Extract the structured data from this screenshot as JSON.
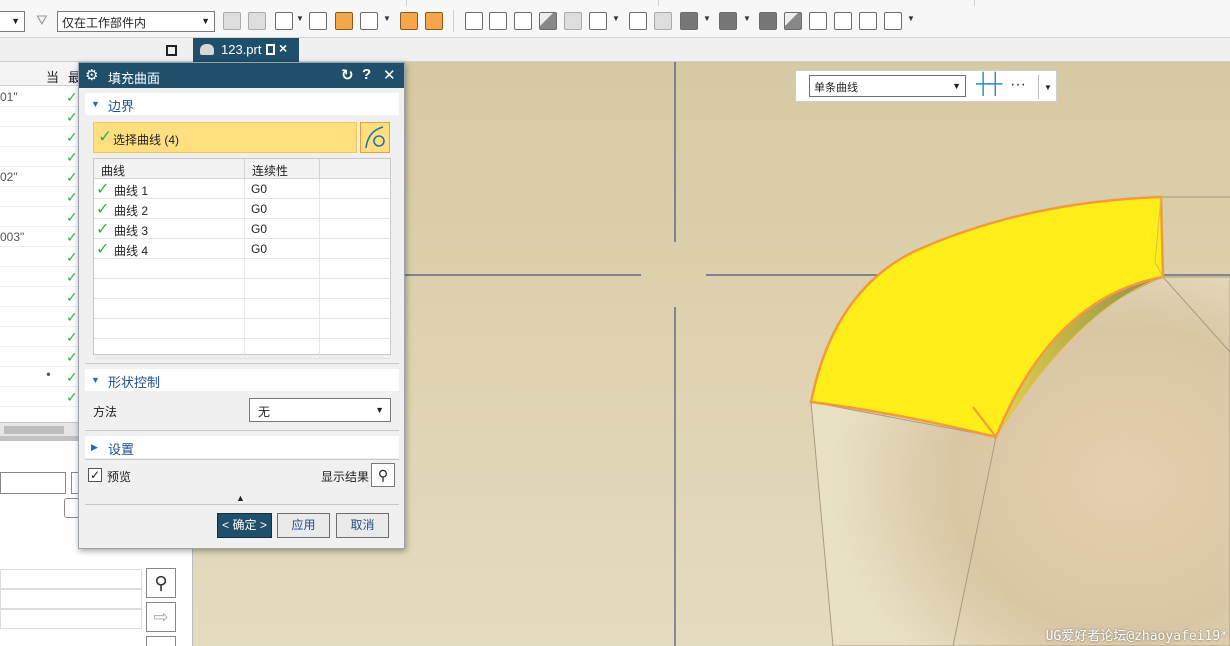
{
  "toolbar": {
    "left_dropdown_value": "",
    "filter_dropdown_value": "仅在工作部件内",
    "buttons": [
      "filter-icon",
      "part-icon",
      "assembly-icon",
      "layer-icon",
      "snap-icon",
      "box-icon",
      "point-icon",
      "view-fit-icon",
      "view-ortho-icon",
      "rotate-icon",
      "shaded-icon",
      "wireframe-icon",
      "zoom-icon",
      "zoom-box-icon",
      "grid-icon",
      "render-icon",
      "solid-cube-icon",
      "cube-dark-icon",
      "cube-edge-icon",
      "cube-outline-icon",
      "cube-hidden-icon",
      "cube-transparent-icon",
      "display-icon"
    ]
  },
  "tab": {
    "label": "123.prt"
  },
  "navigator": {
    "col_current": "当",
    "col_last": "最",
    "rows": [
      {
        "text": "01\"",
        "icon": ""
      },
      {
        "text": "",
        "icon": ""
      },
      {
        "text": "",
        "icon": ""
      },
      {
        "text": "",
        "icon": ""
      },
      {
        "text": "02\"",
        "icon": ""
      },
      {
        "text": "",
        "icon": ""
      },
      {
        "text": "",
        "icon": ""
      },
      {
        "text": "003\"",
        "icon": ""
      },
      {
        "text": "",
        "icon": ""
      },
      {
        "text": "",
        "icon": ""
      },
      {
        "text": "",
        "icon": ""
      },
      {
        "text": "",
        "icon": ""
      },
      {
        "text": "",
        "icon": ""
      },
      {
        "text": "",
        "icon": ""
      },
      {
        "text": "",
        "icon": "ꔷ"
      },
      {
        "text": "",
        "icon": ""
      }
    ]
  },
  "selection_bar": {
    "filter_value": "单条曲线",
    "more": "···"
  },
  "dialog": {
    "title": "填充曲面",
    "reset_symbol": "↻",
    "help_symbol": "?",
    "close_symbol": "✕",
    "boundary": {
      "header": "边界",
      "select_label": "选择曲线 (4)",
      "columns": [
        "曲线",
        "连续性"
      ],
      "rows": [
        {
          "curve": "曲线 1",
          "continuity": "G0"
        },
        {
          "curve": "曲线 2",
          "continuity": "G0"
        },
        {
          "curve": "曲线 3",
          "continuity": "G0"
        },
        {
          "curve": "曲线 4",
          "continuity": "G0"
        }
      ]
    },
    "shape_control": {
      "header": "形状控制",
      "method_label": "方法",
      "method_value": "无"
    },
    "settings": {
      "header": "设置"
    },
    "preview_label": "预览",
    "preview_checked": true,
    "show_result_label": "显示结果",
    "ok_label": "< 确定 >",
    "apply_label": "应用",
    "cancel_label": "取消"
  },
  "watermark": "UG爱好者论坛@zhaoyafei19*",
  "colors": {
    "title_bar": "#1f4f6b",
    "selection_highlight": "#ffdf80",
    "surface_yellow": "#ffee1a",
    "surface_edge": "#f39a3a",
    "check_green": "#2fb24a"
  }
}
